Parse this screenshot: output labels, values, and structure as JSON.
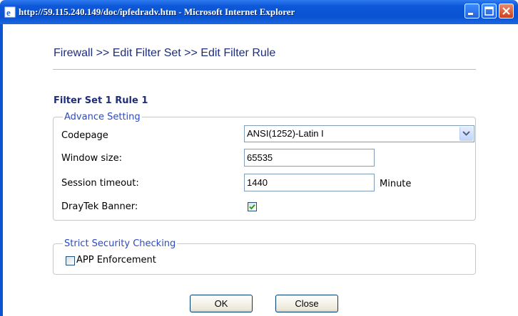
{
  "window": {
    "title": "http://59.115.240.149/doc/ipfedradv.htm - Microsoft Internet Explorer",
    "controls": [
      "minimize",
      "maximize",
      "close"
    ]
  },
  "page": {
    "breadcrumb": "Firewall >> Edit Filter Set >> Edit Filter Rule",
    "subtitle": "Filter Set 1 Rule 1"
  },
  "advance_setting": {
    "legend": "Advance Setting",
    "codepage_label": "Codepage",
    "codepage_value": "ANSI(1252)-Latin I",
    "window_size_label": "Window size:",
    "window_size_value": "65535",
    "session_timeout_label": "Session timeout:",
    "session_timeout_value": "1440",
    "session_timeout_unit": "Minute",
    "draytek_banner_label": "DrayTek Banner:",
    "draytek_banner_checked": true
  },
  "strict_security": {
    "legend": "Strict Security Checking",
    "app_enforcement_label": "APP Enforcement",
    "app_enforcement_checked": false
  },
  "buttons": {
    "ok_label": "OK",
    "close_label": "Close"
  },
  "colors": {
    "titlebar": "#0853d2",
    "heading": "#1f2d7a",
    "legend": "#2b4ac0",
    "close_button": "#c8421c"
  }
}
